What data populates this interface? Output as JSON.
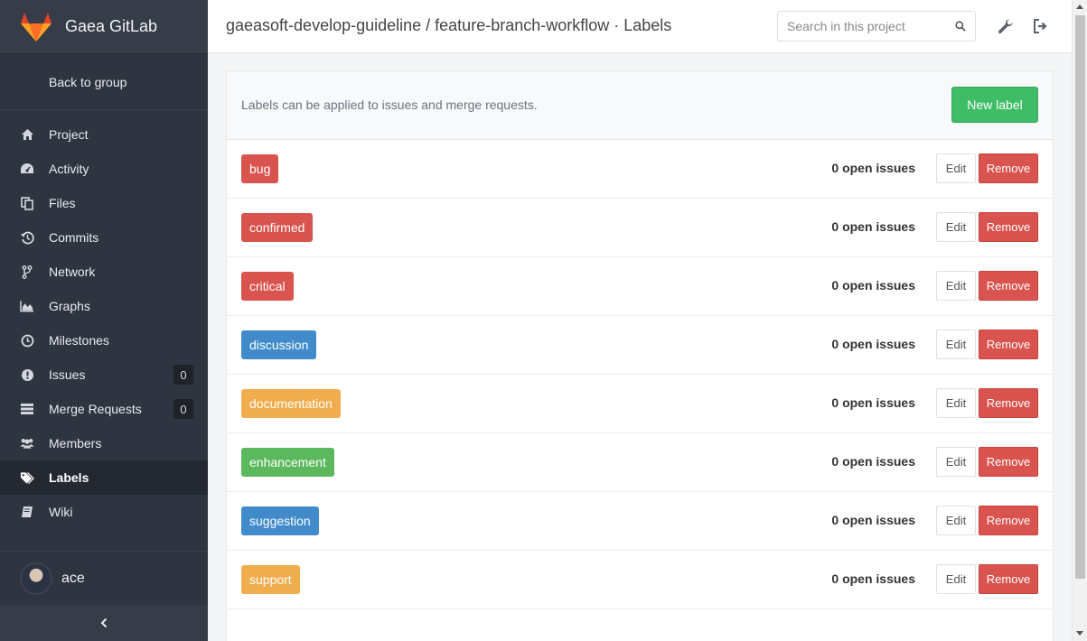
{
  "app": {
    "title": "Gaea GitLab"
  },
  "sidebar": {
    "back_label": "Back to group",
    "items": [
      {
        "label": "Project",
        "icon": "home-icon"
      },
      {
        "label": "Activity",
        "icon": "dashboard-icon"
      },
      {
        "label": "Files",
        "icon": "files-icon"
      },
      {
        "label": "Commits",
        "icon": "history-icon"
      },
      {
        "label": "Network",
        "icon": "code-fork-icon"
      },
      {
        "label": "Graphs",
        "icon": "area-chart-icon"
      },
      {
        "label": "Milestones",
        "icon": "clock-icon"
      },
      {
        "label": "Issues",
        "icon": "exclamation-circle-icon",
        "count": "0"
      },
      {
        "label": "Merge Requests",
        "icon": "tasks-icon",
        "count": "0"
      },
      {
        "label": "Members",
        "icon": "users-icon"
      },
      {
        "label": "Labels",
        "icon": "tags-icon",
        "active": true
      },
      {
        "label": "Wiki",
        "icon": "book-icon"
      }
    ],
    "user": {
      "name": "ace"
    }
  },
  "header": {
    "breadcrumb": "gaeasoft-develop-guideline / feature-branch-workflow · Labels",
    "search_placeholder": "Search in this project"
  },
  "labels_page": {
    "description": "Labels can be applied to issues and merge requests.",
    "new_label_button": "New label",
    "edit_label": "Edit",
    "remove_label": "Remove",
    "labels": [
      {
        "name": "bug",
        "color": "#d9534f",
        "open_issues": "0 open issues"
      },
      {
        "name": "confirmed",
        "color": "#d9534f",
        "open_issues": "0 open issues"
      },
      {
        "name": "critical",
        "color": "#d9534f",
        "open_issues": "0 open issues"
      },
      {
        "name": "discussion",
        "color": "#428bca",
        "open_issues": "0 open issues"
      },
      {
        "name": "documentation",
        "color": "#f0ad4e",
        "open_issues": "0 open issues"
      },
      {
        "name": "enhancement",
        "color": "#5cb85c",
        "open_issues": "0 open issues"
      },
      {
        "name": "suggestion",
        "color": "#428bca",
        "open_issues": "0 open issues"
      },
      {
        "name": "support",
        "color": "#f0ad4e",
        "open_issues": "0 open issues"
      }
    ]
  }
}
